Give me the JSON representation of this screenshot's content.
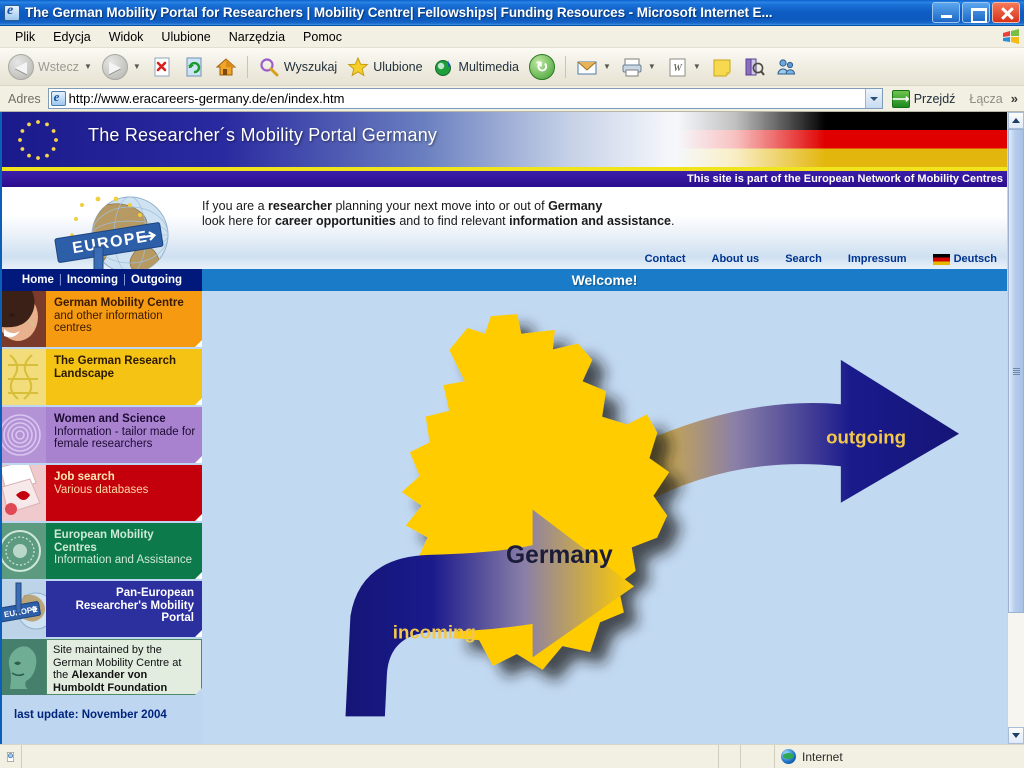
{
  "window": {
    "title": "The German Mobility Portal for Researchers | Mobility Centre| Fellowships| Funding Resources - Microsoft Internet E...",
    "app_icon": "ie-icon",
    "minimize_label": "minimize-icon",
    "maximize_label": "restore-icon",
    "close_label": "close-icon"
  },
  "menubar": {
    "items": [
      {
        "label": "Plik"
      },
      {
        "label": "Edycja"
      },
      {
        "label": "Widok"
      },
      {
        "label": "Ulubione"
      },
      {
        "label": "Narzędzia"
      },
      {
        "label": "Pomoc"
      }
    ]
  },
  "toolbar": {
    "back": "Wstecz",
    "forward": "",
    "stop": "stop-icon",
    "refresh": "refresh-icon",
    "home": "home-icon",
    "search": "Wyszukaj",
    "favorites": "Ulubione",
    "media": "Multimedia",
    "history": "history-icon",
    "mail": "mail-icon",
    "print": "print-icon",
    "edit_word": "edit-word-icon",
    "notes": "notes-icon",
    "research": "research-icon",
    "messenger": "messenger-icon"
  },
  "address": {
    "label": "Adres",
    "url": "http://www.eracareers-germany.de/en/index.htm",
    "placeholder": "",
    "go_label": "Przejdź",
    "links_label": "Łącza",
    "chevron": "»"
  },
  "page": {
    "banner_title": "The Researcher´s Mobility Portal Germany",
    "network_note": "This site is part of the European Network of Mobility Centres",
    "intro": {
      "line1_a": "If you are a ",
      "line1_b": "researcher",
      "line1_c": " planning your next move into or out of ",
      "line1_d": "Germany",
      "line2_a": "look here for ",
      "line2_b": "career opportunities",
      "line2_c": " and to find relevant ",
      "line2_d": "information and assistance",
      "line2_e": "."
    },
    "logo_sign_text": "EUROPE",
    "top_links": [
      {
        "label": "Contact"
      },
      {
        "label": "About us"
      },
      {
        "label": "Search"
      },
      {
        "label": "Impressum"
      }
    ],
    "language_switch": {
      "label": "Deutsch",
      "flag": "german-flag-icon"
    },
    "breadcrumbs": [
      {
        "label": "Home"
      },
      {
        "label": "Incoming"
      },
      {
        "label": "Outgoing"
      }
    ],
    "breadcrumb_separator": "|",
    "welcome_title": "Welcome!",
    "sidebar": {
      "items": [
        {
          "title": "German Mobility Centre",
          "subtitle": "and other information centres",
          "bg": "#f59a11",
          "title_color": "#3a1a00",
          "text_color": "#3a1a00"
        },
        {
          "title": "The German Research Landscape",
          "subtitle": "",
          "bg": "#f5c313",
          "title_color": "#2b1a00",
          "text_color": "#2b1a00"
        },
        {
          "title": "Women and Science",
          "subtitle": "Information - tailor made for female researchers",
          "bg": "#a882cf",
          "title_color": "#1d0b35",
          "text_color": "#1d0b35"
        },
        {
          "title": "Job search",
          "subtitle": "Various databases",
          "bg": "#c4000c",
          "title_color": "#ffe9b0",
          "text_color": "#ffd9a8"
        },
        {
          "title": "European Mobility Centres",
          "subtitle": "Information and Assistance",
          "bg": "#0c7a4a",
          "title_color": "#cfe9d4",
          "text_color": "#cfe9d4"
        },
        {
          "title": "Pan-European Researcher's Mobility Portal",
          "subtitle": "",
          "bg": "#2c2f9e",
          "title_color": "#ffffff",
          "text_color": "#ffffff"
        }
      ],
      "maintainer": {
        "line1": "Site maintained by the",
        "line2": "German Mobility Centre at",
        "line3_a": "the ",
        "line3_b": "Alexander von",
        "line4": "Humboldt Foundation"
      },
      "last_update": "last update: November 2004"
    },
    "map": {
      "country_label": "Germany",
      "outgoing_label": "outgoing",
      "incoming_label": "incoming",
      "country_color": "#ffcc00",
      "arrow_color": "#1a1a8c",
      "background_color": "#c2d9f2"
    }
  },
  "statusbar": {
    "message": "",
    "zone": "Internet",
    "zone_icon": "internet-globe-icon"
  },
  "colors": {
    "title_bar": "#0d5ac0",
    "accent_blue": "#00197a",
    "welcome_blue": "#1a7cc8",
    "page_blue": "#c2d9f2",
    "yellow_rule": "#f2e41c"
  }
}
